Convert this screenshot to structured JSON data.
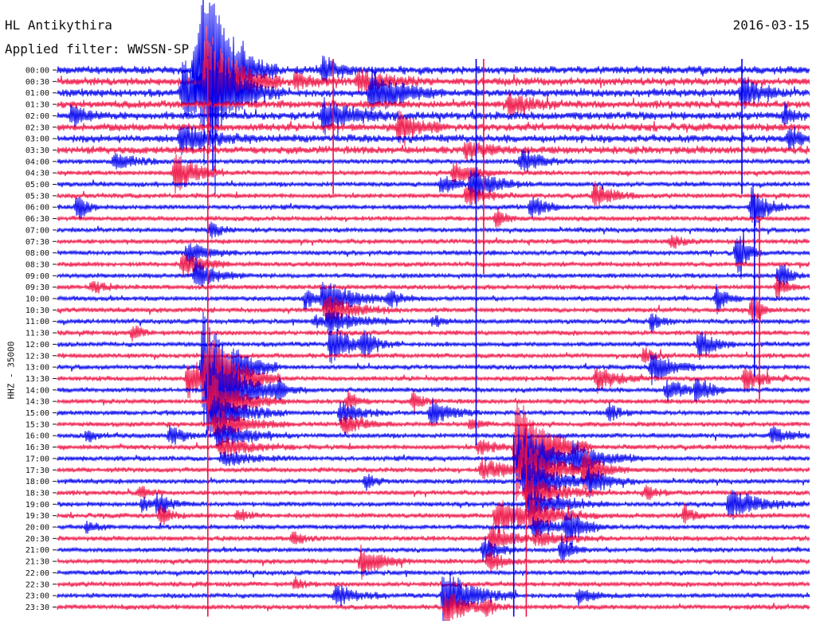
{
  "header": {
    "station": "HL Antikythira",
    "date": "2016-03-15",
    "filter_label": "Applied filter: WWSSN-SP"
  },
  "channel_label": "HHZ - 35000",
  "colors": {
    "trace_a": "#0000ee",
    "trace_b": "#ee1144",
    "text": "#111111",
    "background": "#ffffff"
  },
  "chart_data": {
    "type": "line",
    "ylabel": "HHZ - 35000",
    "y_ticks": [
      "00:00",
      "00:30",
      "01:00",
      "01:30",
      "02:00",
      "02:30",
      "03:00",
      "03:30",
      "04:00",
      "04:30",
      "05:00",
      "05:30",
      "06:00",
      "06:30",
      "07:00",
      "07:30",
      "08:00",
      "08:30",
      "09:00",
      "09:30",
      "10:00",
      "10:30",
      "11:00",
      "11:30",
      "12:00",
      "12:30",
      "13:00",
      "13:30",
      "14:00",
      "14:30",
      "15:00",
      "15:30",
      "16:00",
      "16:30",
      "17:00",
      "17:30",
      "18:00",
      "18:30",
      "19:00",
      "19:30",
      "20:00",
      "20:30",
      "21:00",
      "21:30",
      "22:00",
      "22:30",
      "23:00",
      "23:30"
    ],
    "y_range": [
      "00:00",
      "24:00"
    ],
    "x_range_minutes": [
      0,
      30
    ],
    "series_colors_alternating": [
      "#0000ee",
      "#ee1144"
    ],
    "grid": false,
    "events": [
      {
        "row": 0,
        "minute": 5.5,
        "amp": 55,
        "dur": 2.5
      },
      {
        "row": 0,
        "minute": 10.6,
        "amp": 20,
        "dur": 1.5
      },
      {
        "row": 1,
        "minute": 9.5,
        "amp": 10,
        "dur": 2
      },
      {
        "row": 1,
        "minute": 12.0,
        "amp": 14,
        "dur": 3
      },
      {
        "row": 2,
        "minute": 5.0,
        "amp": 40,
        "dur": 3
      },
      {
        "row": 2,
        "minute": 12.5,
        "amp": 30,
        "dur": 3
      },
      {
        "row": 2,
        "minute": 27.3,
        "amp": 20,
        "dur": 2
      },
      {
        "row": 3,
        "minute": 18.0,
        "amp": 15,
        "dur": 2
      },
      {
        "row": 4,
        "minute": 0.6,
        "amp": 12,
        "dur": 1.5
      },
      {
        "row": 4,
        "minute": 10.6,
        "amp": 22,
        "dur": 3
      },
      {
        "row": 4,
        "minute": 29.0,
        "amp": 14,
        "dur": 1
      },
      {
        "row": 5,
        "minute": 13.6,
        "amp": 18,
        "dur": 2
      },
      {
        "row": 6,
        "minute": 4.9,
        "amp": 20,
        "dur": 3
      },
      {
        "row": 6,
        "minute": 29.2,
        "amp": 18,
        "dur": 1
      },
      {
        "row": 7,
        "minute": 16.3,
        "amp": 12,
        "dur": 2
      },
      {
        "row": 8,
        "minute": 2.3,
        "amp": 12,
        "dur": 2
      },
      {
        "row": 8,
        "minute": 18.5,
        "amp": 16,
        "dur": 2
      },
      {
        "row": 9,
        "minute": 4.7,
        "amp": 30,
        "dur": 2
      },
      {
        "row": 9,
        "minute": 15.8,
        "amp": 16,
        "dur": 2
      },
      {
        "row": 10,
        "minute": 15.3,
        "amp": 12,
        "dur": 1.5
      },
      {
        "row": 10,
        "minute": 16.5,
        "amp": 22,
        "dur": 2.5
      },
      {
        "row": 11,
        "minute": 16.3,
        "amp": 12,
        "dur": 2
      },
      {
        "row": 11,
        "minute": 21.4,
        "amp": 15,
        "dur": 2
      },
      {
        "row": 12,
        "minute": 0.8,
        "amp": 18,
        "dur": 1
      },
      {
        "row": 12,
        "minute": 18.9,
        "amp": 15,
        "dur": 1.5
      },
      {
        "row": 12,
        "minute": 27.7,
        "amp": 28,
        "dur": 1.5
      },
      {
        "row": 13,
        "minute": 17.5,
        "amp": 15,
        "dur": 1
      },
      {
        "row": 14,
        "minute": 6.1,
        "amp": 12,
        "dur": 1
      },
      {
        "row": 15,
        "minute": 24.5,
        "amp": 10,
        "dur": 1
      },
      {
        "row": 16,
        "minute": 5.2,
        "amp": 15,
        "dur": 2
      },
      {
        "row": 16,
        "minute": 27.1,
        "amp": 30,
        "dur": 1
      },
      {
        "row": 17,
        "minute": 5.0,
        "amp": 18,
        "dur": 2
      },
      {
        "row": 18,
        "minute": 5.5,
        "amp": 20,
        "dur": 2
      },
      {
        "row": 18,
        "minute": 28.8,
        "amp": 22,
        "dur": 1
      },
      {
        "row": 19,
        "minute": 1.4,
        "amp": 10,
        "dur": 1
      },
      {
        "row": 19,
        "minute": 28.7,
        "amp": 14,
        "dur": 1
      },
      {
        "row": 20,
        "minute": 9.9,
        "amp": 15,
        "dur": 1
      },
      {
        "row": 20,
        "minute": 13.2,
        "amp": 10,
        "dur": 1.5
      },
      {
        "row": 20,
        "minute": 26.3,
        "amp": 20,
        "dur": 1
      },
      {
        "row": 21,
        "minute": 27.7,
        "amp": 18,
        "dur": 1
      },
      {
        "row": 22,
        "minute": 10.3,
        "amp": 8,
        "dur": 1
      },
      {
        "row": 22,
        "minute": 15.0,
        "amp": 8,
        "dur": 1
      },
      {
        "row": 22,
        "minute": 23.7,
        "amp": 12,
        "dur": 1
      },
      {
        "row": 23,
        "minute": 3.0,
        "amp": 10,
        "dur": 1
      },
      {
        "row": 24,
        "minute": 10.9,
        "amp": 25,
        "dur": 2
      },
      {
        "row": 24,
        "minute": 12.2,
        "amp": 15,
        "dur": 1.5
      },
      {
        "row": 24,
        "minute": 25.6,
        "amp": 20,
        "dur": 1.5
      },
      {
        "row": 25,
        "minute": 23.4,
        "amp": 10,
        "dur": 1
      },
      {
        "row": 26,
        "minute": 23.7,
        "amp": 22,
        "dur": 2
      },
      {
        "row": 27,
        "minute": 5.2,
        "amp": 25,
        "dur": 3
      },
      {
        "row": 27,
        "minute": 21.5,
        "amp": 18,
        "dur": 2
      },
      {
        "row": 27,
        "minute": 27.4,
        "amp": 15,
        "dur": 2
      },
      {
        "row": 28,
        "minute": 6.0,
        "amp": 20,
        "dur": 4
      },
      {
        "row": 28,
        "minute": 8.8,
        "amp": 10,
        "dur": 1
      },
      {
        "row": 28,
        "minute": 24.3,
        "amp": 15,
        "dur": 2
      },
      {
        "row": 28,
        "minute": 25.5,
        "amp": 15,
        "dur": 1.5
      },
      {
        "row": 29,
        "minute": 11.6,
        "amp": 14,
        "dur": 1
      },
      {
        "row": 29,
        "minute": 14.2,
        "amp": 14,
        "dur": 1
      },
      {
        "row": 30,
        "minute": 11.3,
        "amp": 15,
        "dur": 2
      },
      {
        "row": 30,
        "minute": 14.9,
        "amp": 18,
        "dur": 2
      },
      {
        "row": 30,
        "minute": 22.0,
        "amp": 12,
        "dur": 1
      },
      {
        "row": 31,
        "minute": 11.4,
        "amp": 15,
        "dur": 2
      },
      {
        "row": 31,
        "minute": 16.5,
        "amp": 8,
        "dur": 1
      },
      {
        "row": 32,
        "minute": 1.2,
        "amp": 8,
        "dur": 1
      },
      {
        "row": 32,
        "minute": 4.5,
        "amp": 12,
        "dur": 1.5
      },
      {
        "row": 32,
        "minute": 28.5,
        "amp": 12,
        "dur": 1.5
      },
      {
        "row": 33,
        "minute": 16.8,
        "amp": 10,
        "dur": 2
      },
      {
        "row": 34,
        "minute": 20.6,
        "amp": 18,
        "dur": 3
      },
      {
        "row": 35,
        "minute": 16.9,
        "amp": 14,
        "dur": 3
      },
      {
        "row": 35,
        "minute": 21.0,
        "amp": 25,
        "dur": 2
      },
      {
        "row": 36,
        "minute": 12.3,
        "amp": 10,
        "dur": 1
      },
      {
        "row": 36,
        "minute": 21.2,
        "amp": 20,
        "dur": 2
      },
      {
        "row": 37,
        "minute": 3.3,
        "amp": 10,
        "dur": 1
      },
      {
        "row": 37,
        "minute": 23.5,
        "amp": 10,
        "dur": 1
      },
      {
        "row": 38,
        "minute": 3.4,
        "amp": 10,
        "dur": 1
      },
      {
        "row": 38,
        "minute": 4.0,
        "amp": 12,
        "dur": 1.5
      },
      {
        "row": 38,
        "minute": 26.8,
        "amp": 20,
        "dur": 3
      },
      {
        "row": 39,
        "minute": 4.1,
        "amp": 15,
        "dur": 1
      },
      {
        "row": 39,
        "minute": 7.2,
        "amp": 10,
        "dur": 1
      },
      {
        "row": 39,
        "minute": 17.5,
        "amp": 25,
        "dur": 3
      },
      {
        "row": 39,
        "minute": 25.0,
        "amp": 15,
        "dur": 1
      },
      {
        "row": 40,
        "minute": 1.2,
        "amp": 8,
        "dur": 1
      },
      {
        "row": 40,
        "minute": 20.3,
        "amp": 25,
        "dur": 1.5
      },
      {
        "row": 41,
        "minute": 17.3,
        "amp": 18,
        "dur": 2
      },
      {
        "row": 41,
        "minute": 9.4,
        "amp": 10,
        "dur": 1
      },
      {
        "row": 42,
        "minute": 17.0,
        "amp": 18,
        "dur": 1.5
      },
      {
        "row": 42,
        "minute": 20.1,
        "amp": 20,
        "dur": 1
      },
      {
        "row": 43,
        "minute": 12.1,
        "amp": 22,
        "dur": 2
      },
      {
        "row": 43,
        "minute": 17.2,
        "amp": 15,
        "dur": 1.5
      },
      {
        "row": 45,
        "minute": 9.5,
        "amp": 8,
        "dur": 1
      },
      {
        "row": 46,
        "minute": 11.1,
        "amp": 15,
        "dur": 2
      },
      {
        "row": 46,
        "minute": 15.4,
        "amp": 35,
        "dur": 3
      },
      {
        "row": 46,
        "minute": 20.8,
        "amp": 12,
        "dur": 1.5
      },
      {
        "row": 47,
        "minute": 15.5,
        "amp": 25,
        "dur": 2
      },
      {
        "row": 47,
        "minute": 17.1,
        "amp": 10,
        "dur": 1
      }
    ],
    "big_events": [
      {
        "start_row": 0,
        "minute": 5.8,
        "amp": 90,
        "rows": 3
      },
      {
        "start_row": 26,
        "minute": 5.8,
        "amp": 75,
        "rows": 9
      },
      {
        "start_row": 33,
        "minute": 18.3,
        "amp": 70,
        "rows": 9
      },
      {
        "start_row": 20,
        "minute": 10.6,
        "amp": 25,
        "rows": 3
      }
    ],
    "spikes": [
      {
        "minute": 6.0,
        "row_from": 0,
        "row_to": 47
      },
      {
        "minute": 6.2,
        "row_from": 0,
        "row_to": 8
      },
      {
        "minute": 11.0,
        "row_from": 0,
        "row_to": 10
      },
      {
        "minute": 16.7,
        "row_from": 0,
        "row_to": 32
      },
      {
        "minute": 17.0,
        "row_from": 0,
        "row_to": 17
      },
      {
        "minute": 18.2,
        "row_from": 33,
        "row_to": 47
      },
      {
        "minute": 18.7,
        "row_from": 32,
        "row_to": 47
      },
      {
        "minute": 27.3,
        "row_from": 0,
        "row_to": 10
      },
      {
        "minute": 28.0,
        "row_from": 14,
        "row_to": 28
      },
      {
        "minute": 27.8,
        "row_from": 12,
        "row_to": 26
      }
    ]
  }
}
